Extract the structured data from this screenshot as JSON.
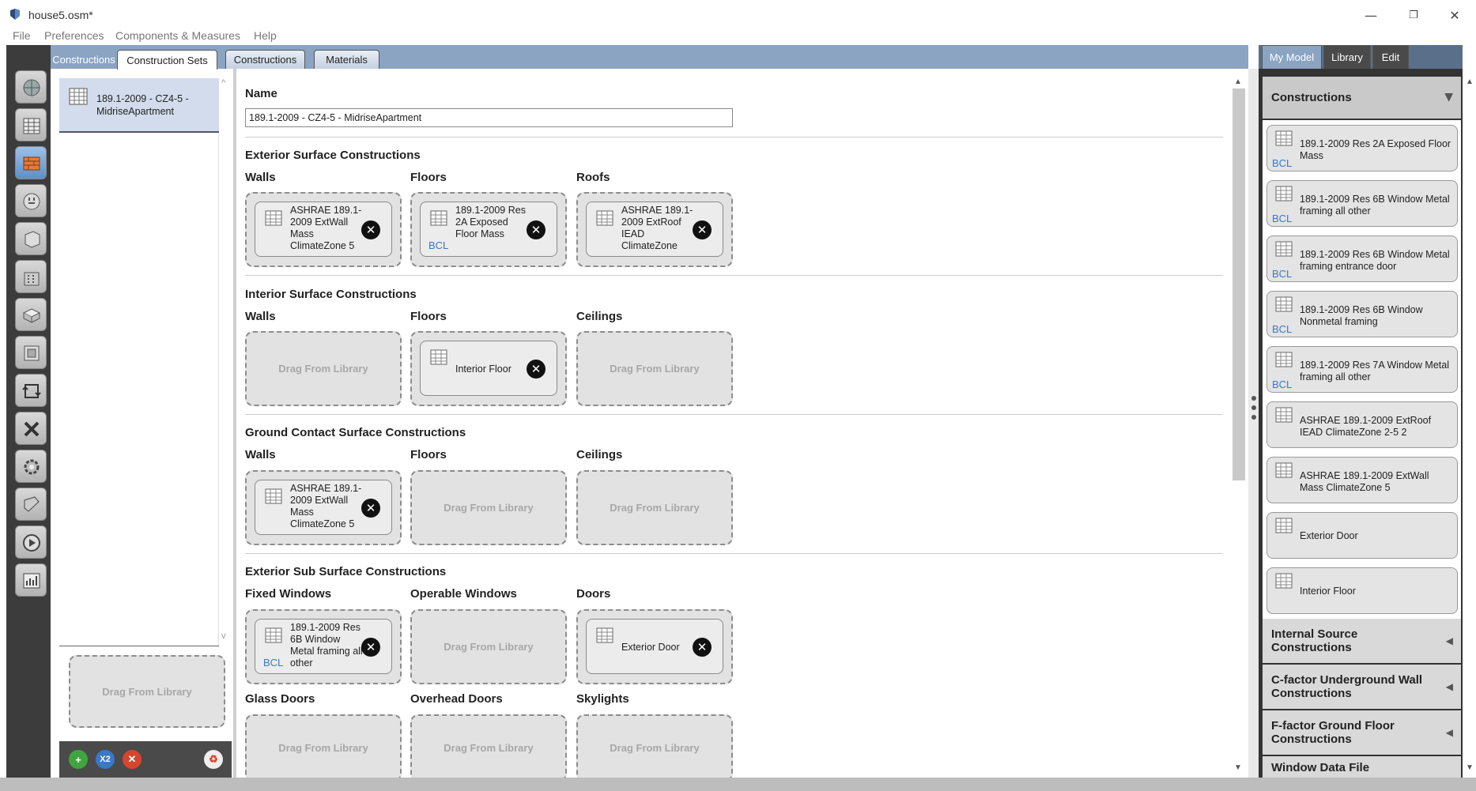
{
  "window": {
    "title": "house5.osm*",
    "minimize": "—",
    "restore": "❐",
    "close": "✕"
  },
  "menu": [
    "File",
    "Preferences",
    "Components & Measures",
    "Help"
  ],
  "left_nav_icons": [
    "site-icon",
    "schedules-icon",
    "constructions-icon",
    "loads-icon",
    "space-types-icon",
    "facility-icon",
    "spaces-icon",
    "thermal-zones-icon",
    "hvac-systems-icon",
    "building-summary-icon",
    "outputs-icon",
    "simulation-settings-icon",
    "run-simulation-icon",
    "results-summary-icon"
  ],
  "tabs": {
    "ghost": "Constructions",
    "items": [
      "Construction Sets",
      "Constructions",
      "Materials"
    ],
    "active": "Construction Sets"
  },
  "list": {
    "item": "189.1-2009 - CZ4-5 - MidriseApartment",
    "drag_label": "Drag From Library"
  },
  "bottom_buttons": {
    "add": "+",
    "copy": "X2",
    "remove": "✕",
    "purge": "♻"
  },
  "name": {
    "label": "Name",
    "value": "189.1-2009 - CZ4-5 - MidriseApartment"
  },
  "drag_label": "Drag From Library",
  "sections": [
    {
      "title": "Exterior Surface Constructions",
      "columns": [
        {
          "label": "Walls",
          "item": "ASHRAE 189.1-2009 ExtWall Mass ClimateZone 5",
          "bcl": ""
        },
        {
          "label": "Floors",
          "item": "189.1-2009 Res 2A Exposed Floor Mass",
          "bcl": "BCL"
        },
        {
          "label": "Roofs",
          "item": "ASHRAE 189.1-2009 ExtRoof IEAD ClimateZone",
          "bcl": ""
        }
      ]
    },
    {
      "title": "Interior Surface Constructions",
      "columns": [
        {
          "label": "Walls",
          "item": "",
          "bcl": ""
        },
        {
          "label": "Floors",
          "item": "Interior Floor",
          "bcl": ""
        },
        {
          "label": "Ceilings",
          "item": "",
          "bcl": ""
        }
      ]
    },
    {
      "title": "Ground Contact Surface Constructions",
      "columns": [
        {
          "label": "Walls",
          "item": "ASHRAE 189.1-2009 ExtWall Mass ClimateZone 5",
          "bcl": ""
        },
        {
          "label": "Floors",
          "item": "",
          "bcl": ""
        },
        {
          "label": "Ceilings",
          "item": "",
          "bcl": ""
        }
      ]
    },
    {
      "title": "Exterior Sub Surface Constructions",
      "columns": [
        {
          "label": "Fixed Windows",
          "item": "189.1-2009 Res 6B Window Metal framing all other",
          "bcl": "BCL"
        },
        {
          "label": "Operable Windows",
          "item": "",
          "bcl": ""
        },
        {
          "label": "Doors",
          "item": "Exterior Door",
          "bcl": ""
        }
      ],
      "columns2": [
        {
          "label": "Glass Doors",
          "item": "",
          "bcl": ""
        },
        {
          "label": "Overhead Doors",
          "item": "",
          "bcl": ""
        },
        {
          "label": "Skylights",
          "item": "",
          "bcl": ""
        }
      ]
    }
  ],
  "right_tabs": [
    "My Model",
    "Library",
    "Edit"
  ],
  "right": {
    "header": "Constructions",
    "items": [
      {
        "name": "189.1-2009 Res 2A Exposed Floor Mass",
        "bcl": "BCL"
      },
      {
        "name": "189.1-2009 Res 6B Window Metal framing all other",
        "bcl": "BCL"
      },
      {
        "name": "189.1-2009 Res 6B Window Metal framing entrance door",
        "bcl": "BCL"
      },
      {
        "name": "189.1-2009 Res 6B Window Nonmetal framing",
        "bcl": "BCL"
      },
      {
        "name": "189.1-2009 Res 7A Window Metal framing all other",
        "bcl": "BCL"
      },
      {
        "name": "ASHRAE 189.1-2009 ExtRoof IEAD ClimateZone 2-5 2",
        "bcl": ""
      },
      {
        "name": "ASHRAE 189.1-2009 ExtWall Mass ClimateZone 5",
        "bcl": ""
      },
      {
        "name": "Exterior Door",
        "bcl": ""
      },
      {
        "name": "Interior Floor",
        "bcl": ""
      }
    ],
    "collapsed": [
      "Internal Source Constructions",
      "C-factor Underground Wall Constructions",
      "F-factor Ground Floor Constructions",
      "Window Data File"
    ]
  }
}
